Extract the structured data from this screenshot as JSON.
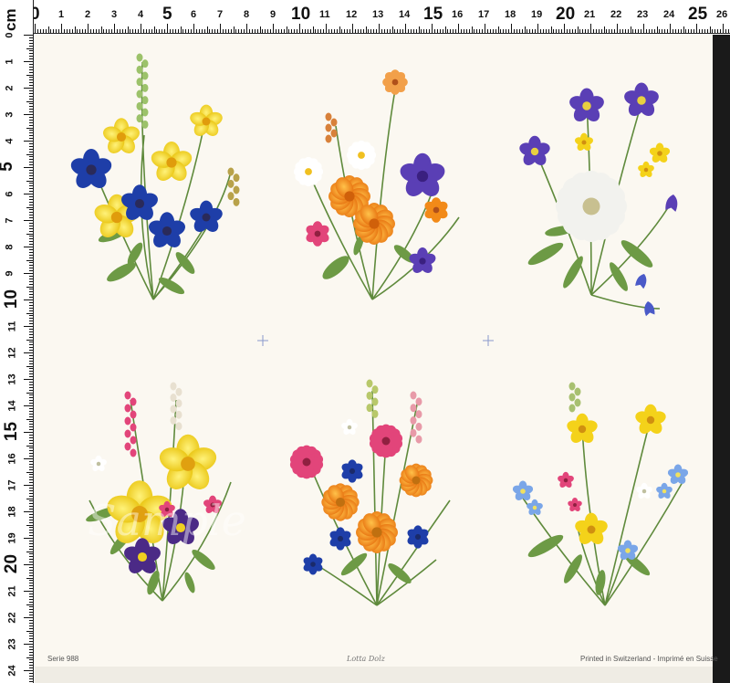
{
  "ruler": {
    "unit_label": "cm",
    "top_labels": [
      "0",
      "1",
      "2",
      "3",
      "4",
      "5",
      "6",
      "7",
      "8",
      "9",
      "10",
      "11",
      "12",
      "13",
      "14",
      "15",
      "16",
      "17",
      "18",
      "19",
      "20",
      "21",
      "22",
      "23",
      "24",
      "25",
      "26"
    ],
    "left_labels": [
      "0",
      "1",
      "2",
      "3",
      "4",
      "5",
      "6",
      "7",
      "8",
      "9",
      "10",
      "11",
      "12",
      "13",
      "14",
      "15",
      "16",
      "17",
      "18",
      "19",
      "20",
      "21",
      "22",
      "23",
      "24"
    ]
  },
  "sheet": {
    "watermark": "Sample",
    "series_text": "Serie 988",
    "signature_text": "Lotta Dolz",
    "printed_text": "Printed in Switzerland - Imprimé en Suisse"
  },
  "bouquets": [
    {
      "name": "gentian-buttercup-bouquet",
      "flowers": [
        "yellow",
        "blue"
      ]
    },
    {
      "name": "daisy-marigold-bouquet",
      "flowers": [
        "orange",
        "purple",
        "white"
      ]
    },
    {
      "name": "columbine-thistle-bouquet",
      "flowers": [
        "purple",
        "white",
        "yellow"
      ]
    },
    {
      "name": "foxglove-pansy-bouquet",
      "flowers": [
        "pink",
        "yellow",
        "violet"
      ]
    },
    {
      "name": "cornflower-arnica-bouquet",
      "flowers": [
        "blue",
        "orange",
        "pink"
      ]
    },
    {
      "name": "forget-me-not-bouquet",
      "flowers": [
        "yellow",
        "light-blue",
        "pink"
      ]
    }
  ],
  "colors": {
    "sheet": "#fbf8f1",
    "yellow": "#f4d21a",
    "blue": "#1e3ea8",
    "purple": "#5a3fb5",
    "orange": "#f28a18",
    "pink": "#e2457a",
    "stem": "#5f8a3c"
  }
}
